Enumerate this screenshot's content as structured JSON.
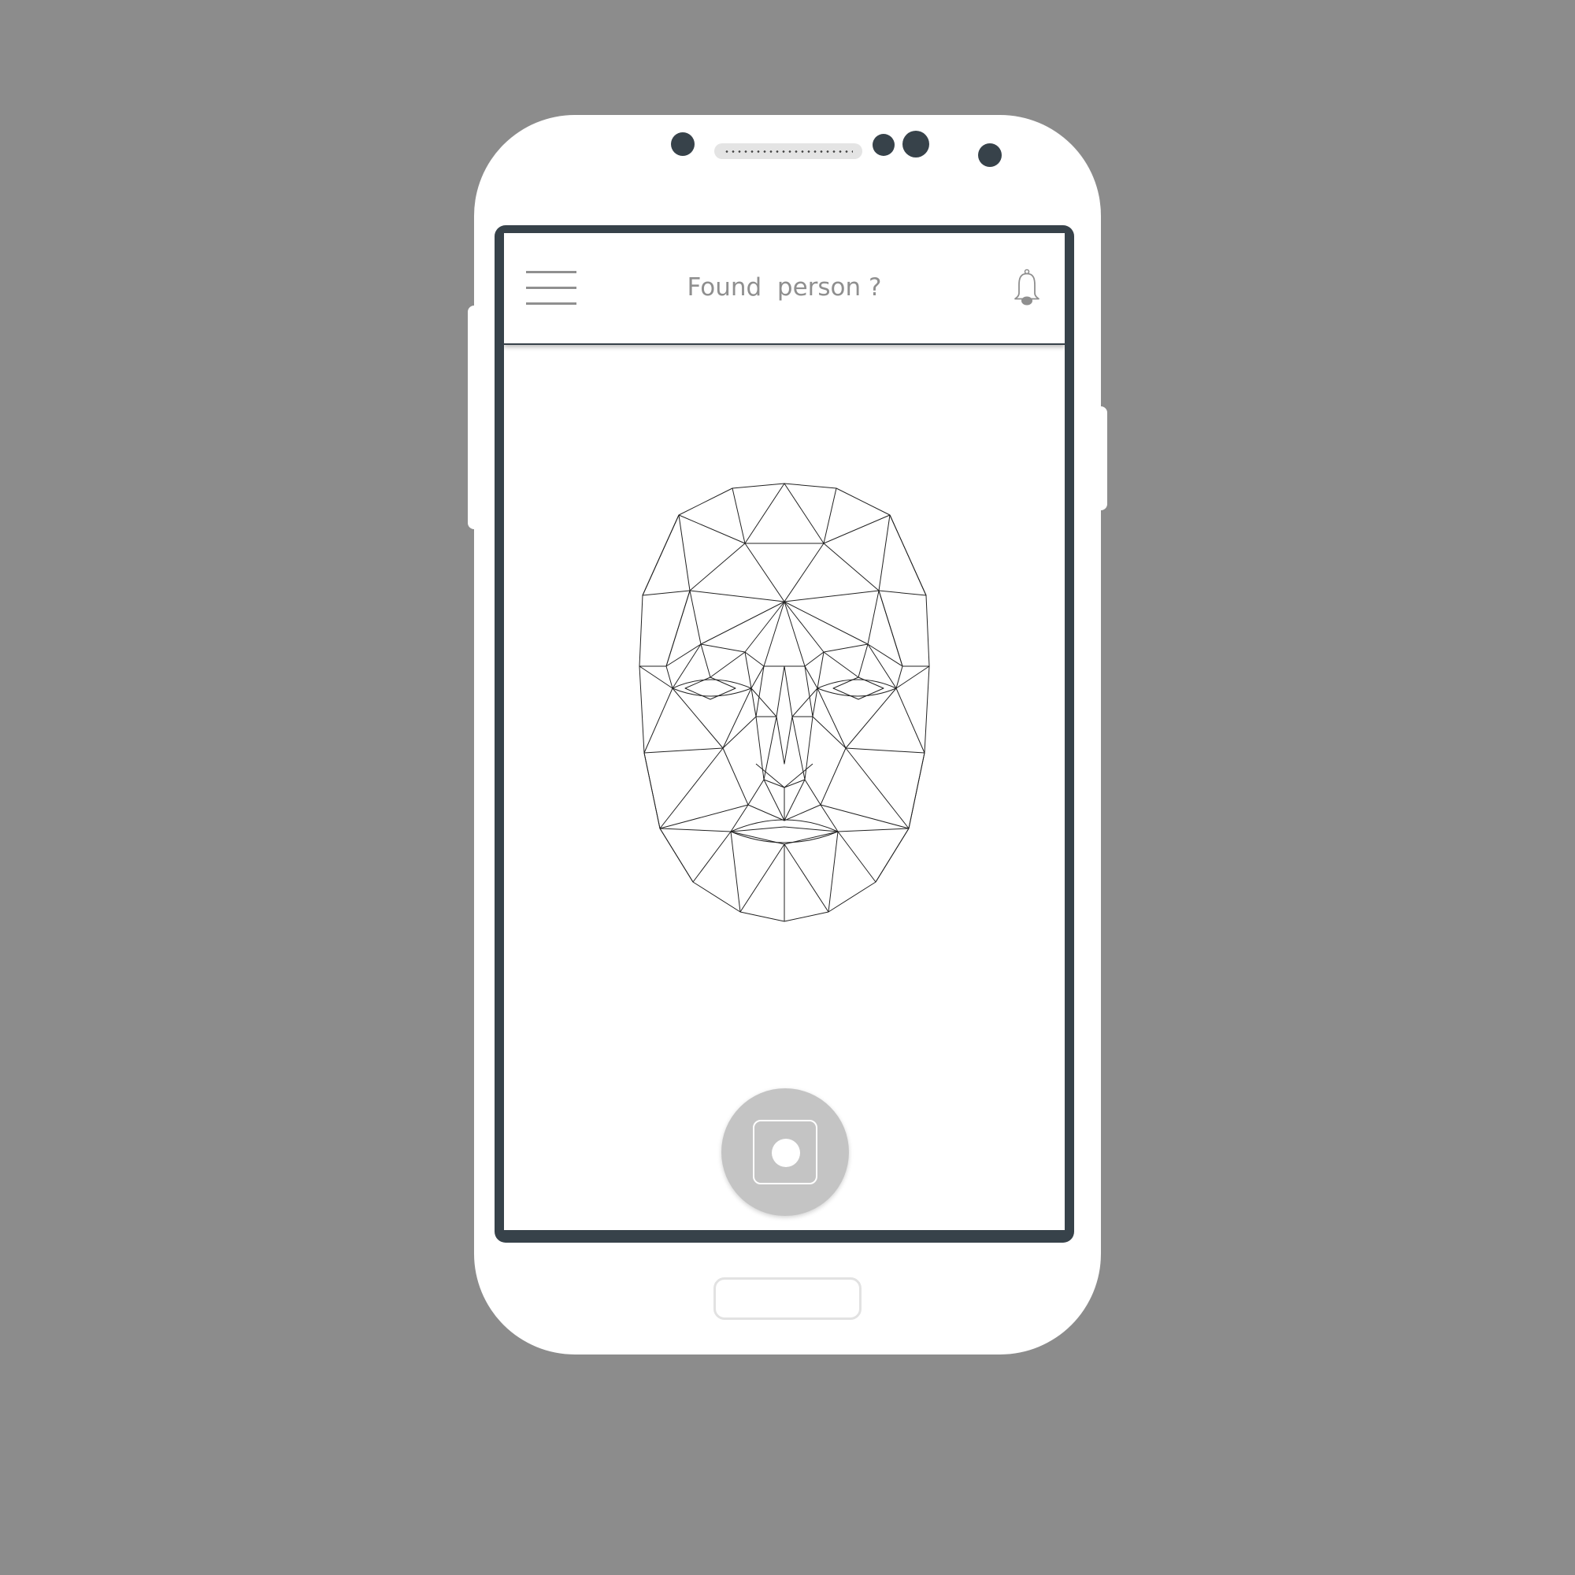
{
  "app": {
    "title": "Found  person ?"
  },
  "icons": {
    "menu": "hamburger-menu-icon",
    "notifications": "bell-icon",
    "capture": "camera-shutter-icon",
    "illustration": "face-mesh-illustration"
  },
  "colors": {
    "background": "#8c8c8c",
    "phone_body": "#ffffff",
    "screen_frame": "#37424a",
    "text_gray": "#8f8f8f",
    "shutter": "#c4c4c4"
  }
}
